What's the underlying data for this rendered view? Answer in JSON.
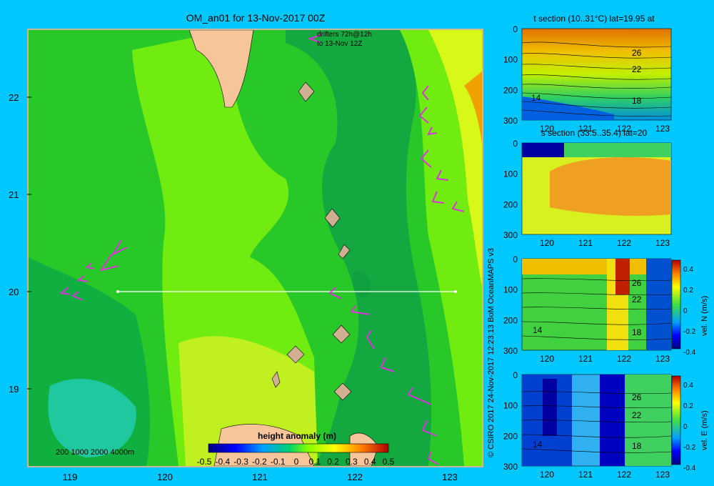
{
  "main_map": {
    "title": "OM_an01 for 13-Nov-2017 00Z",
    "drifters_line1": "drifters 72h@12h",
    "drifters_line2": "to 13-Nov 12Z",
    "lat_ticks": [
      "22",
      "21",
      "20",
      "19"
    ],
    "lon_ticks": [
      "119",
      "120",
      "121",
      "122",
      "123"
    ],
    "depth_legend": "200  1000  2000  4000m",
    "colorbar_title": "height anomaly (m)",
    "colorbar_ticks": [
      "-0.5",
      "-0.4",
      "-0.3",
      "-0.2",
      "-0.1",
      "0",
      "0.1",
      "0.2",
      "0.3",
      "0.4",
      "0.5"
    ]
  },
  "credit": "© CSIRO 2017   24-Nov-2017 12:23:13 BoM OceanMAPS v3",
  "sections": {
    "t": {
      "title": "t section (10..31°C) lat=19.95 at",
      "y_ticks": [
        "0",
        "100",
        "200",
        "300"
      ],
      "x_ticks": [
        "120",
        "121",
        "122",
        "123"
      ],
      "contour_labels": [
        "26",
        "22",
        "18",
        "14"
      ]
    },
    "s": {
      "title": "s section (33.5..35.4) lat=20",
      "y_ticks": [
        "0",
        "100",
        "200",
        "300"
      ],
      "x_ticks": [
        "120",
        "121",
        "122",
        "123"
      ]
    },
    "n": {
      "y_ticks": [
        "0",
        "100",
        "200",
        "300"
      ],
      "x_ticks": [
        "120",
        "121",
        "122",
        "123"
      ],
      "contour_labels": [
        "26",
        "22",
        "18",
        "14"
      ],
      "cb_ticks": [
        "0.4",
        "0.2",
        "0",
        "-0.2",
        "-0.4"
      ],
      "cb_label": "vel. N (m/s)"
    },
    "e": {
      "y_ticks": [
        "0",
        "100",
        "200",
        "300"
      ],
      "x_ticks": [
        "120",
        "121",
        "122",
        "123"
      ],
      "contour_labels": [
        "26",
        "22",
        "18",
        "14"
      ],
      "cb_ticks": [
        "0.4",
        "0.2",
        "0",
        "-0.2",
        "-0.4"
      ],
      "cb_label": "vel. E (m/s)"
    }
  },
  "colors": {
    "background": "#00c8ff",
    "land": "#f7c59a",
    "drifter": "#e030e0"
  }
}
